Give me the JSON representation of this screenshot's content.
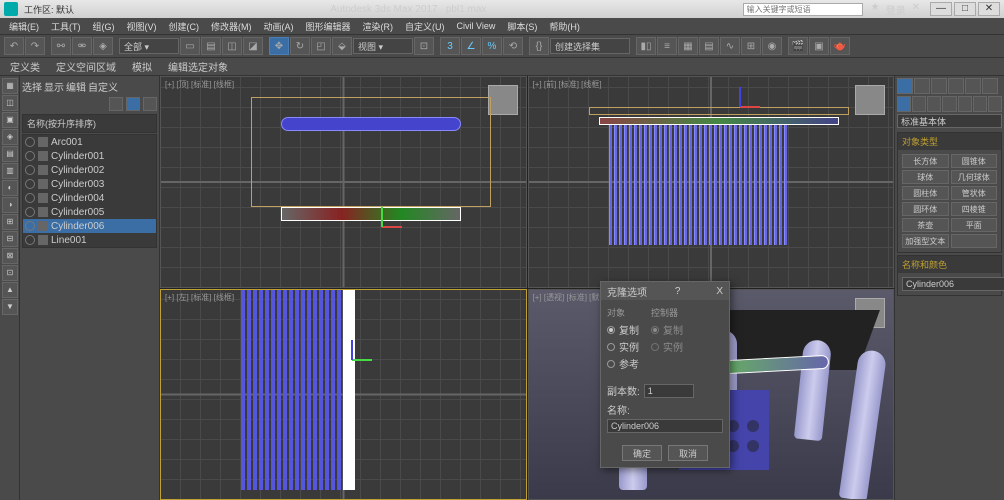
{
  "titlebar": {
    "workspace": "工作区: 默认",
    "app": "Autodesk 3ds Max 2017",
    "file": "pbl1.max",
    "search_ph": "输入关键字或短语",
    "login": "登录"
  },
  "menus": [
    "编辑(E)",
    "工具(T)",
    "组(G)",
    "视图(V)",
    "创建(C)",
    "修改器(M)",
    "动画(A)",
    "图形编辑器",
    "渲染(R)",
    "自定义(U)",
    "Civil View",
    "脚本(S)",
    "帮助(H)"
  ],
  "toolbar2": [
    "定义类",
    "定义空间区域",
    "模拟",
    "编辑选定对象"
  ],
  "toolbar3": [
    "选择",
    "显示",
    "编辑",
    "自定义"
  ],
  "create_dropdown": "创建选择集",
  "scene": {
    "header": "名称(按升序排序)",
    "items": [
      {
        "name": "Arc001",
        "sel": false
      },
      {
        "name": "Cylinder001",
        "sel": false
      },
      {
        "name": "Cylinder002",
        "sel": false
      },
      {
        "name": "Cylinder003",
        "sel": false
      },
      {
        "name": "Cylinder004",
        "sel": false
      },
      {
        "name": "Cylinder005",
        "sel": false
      },
      {
        "name": "Cylinder006",
        "sel": true
      },
      {
        "name": "Line001",
        "sel": false
      }
    ]
  },
  "viewports": {
    "top": "[+] [顶] [标准] [线框]",
    "front": "[+] [前] [标准] [线框]",
    "left": "[+] [左] [标准] [线框]",
    "persp": "[+] [透视] [标准] [默认明暗处理]"
  },
  "dialog": {
    "title": "克隆选项",
    "help": "?",
    "close": "X",
    "obj_label": "对象",
    "ctrl_label": "控制器",
    "opt_copy": "复制",
    "opt_inst": "实例",
    "opt_ref": "参考",
    "copies_label": "副本数:",
    "copies_val": "1",
    "name_label": "名称:",
    "name_val": "Cylinder006",
    "ok": "确定",
    "cancel": "取消"
  },
  "cmdpanel": {
    "dropdown": "标准基本体",
    "sect1": "对象类型",
    "buttons": [
      "长方体",
      "圆锥体",
      "球体",
      "几何球体",
      "圆柱体",
      "管状体",
      "圆环体",
      "四棱锥",
      "茶壶",
      "平面",
      "加强型文本",
      ""
    ],
    "sect2": "名称和颜色",
    "objname": "Cylinder006"
  }
}
